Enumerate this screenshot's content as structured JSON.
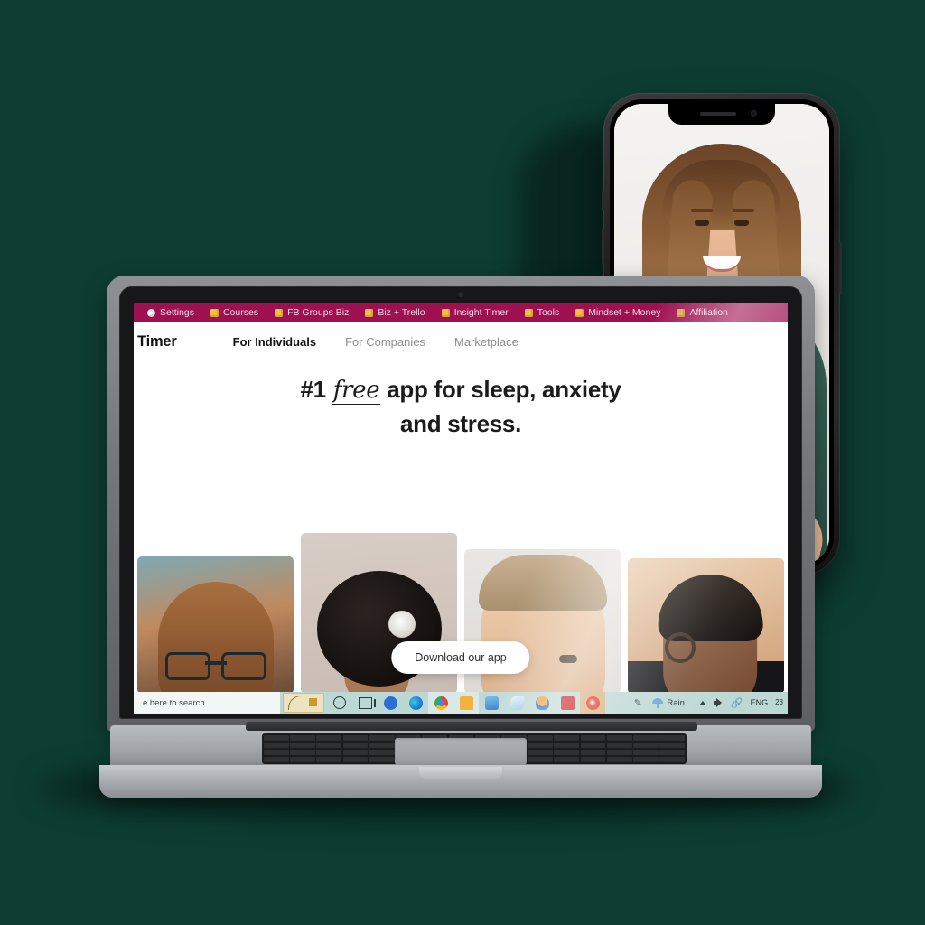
{
  "scene": {
    "background_color": "#0d3d32",
    "devices": [
      "laptop",
      "smartphone"
    ]
  },
  "phone": {
    "name": "smartphone-mockup",
    "screen_content": "woman smiling in namaste prayer pose wearing green t-shirt",
    "notch": {
      "speaker": "earpiece-speaker",
      "camera": "front-camera"
    }
  },
  "laptop": {
    "name": "laptop-mockup",
    "browser": {
      "bookmarks_bar": {
        "background_color": "#9e1050",
        "items": [
          {
            "label": "Settings",
            "icon": "dot-favicon"
          },
          {
            "label": "Courses",
            "icon": "folder-icon"
          },
          {
            "label": "FB Groups Biz",
            "icon": "folder-icon"
          },
          {
            "label": "Biz + Trello",
            "icon": "folder-icon"
          },
          {
            "label": "Insight Timer",
            "icon": "folder-icon"
          },
          {
            "label": "Tools",
            "icon": "folder-icon"
          },
          {
            "label": "Mindset + Money",
            "icon": "folder-icon"
          },
          {
            "label": "Affiliation",
            "icon": "folder-icon"
          }
        ]
      },
      "site": {
        "brand": "Timer",
        "nav": [
          {
            "label": "For Individuals",
            "active": true
          },
          {
            "label": "For Companies",
            "active": false
          },
          {
            "label": "Marketplace",
            "active": false
          }
        ],
        "hero": {
          "line1_before": "#1 ",
          "line1_script": "free",
          "line1_after": " app for sleep, anxiety",
          "line2": "and stress."
        },
        "cta": {
          "label": "Download our app"
        },
        "cards": [
          {
            "alt": "bald man with glasses"
          },
          {
            "alt": "woman with afro hair and white flower"
          },
          {
            "alt": "older man with blond hair"
          },
          {
            "alt": "woman with hoop earring"
          }
        ]
      }
    },
    "taskbar": {
      "background_color": "#bcd8d4",
      "search_placeholder": "e here to search",
      "widget": "golden-spiral-widget",
      "pinned": [
        {
          "name": "cortana-icon"
        },
        {
          "name": "task-view-icon"
        },
        {
          "name": "blue-app-icon",
          "color": "#2b6fd4"
        },
        {
          "name": "edge-icon",
          "color": "#1e8bcd"
        },
        {
          "name": "chrome-icon",
          "color": "#f2b600"
        },
        {
          "name": "file-explorer-icon",
          "color": "#f2b33d"
        },
        {
          "name": "photos-icon",
          "color": "#3b84d6"
        },
        {
          "name": "notes-icon",
          "color": "#cfe3f0"
        },
        {
          "name": "headphones-icon",
          "color": "#2f6fd0"
        },
        {
          "name": "acrobat-icon",
          "color": "#cc2127"
        },
        {
          "name": "active-app-icon",
          "color": "#d63b2a"
        }
      ],
      "tray": {
        "pen_icon": "pen-icon",
        "weather_label": "Rain...",
        "weather_icon": "umbrella-icon",
        "show_hidden_icon": "chevron-up-icon",
        "volume_icon": "speaker-icon",
        "bluetooth_icon": "bluetooth-icon",
        "language": "ENG",
        "clock_line1": "",
        "clock_line2": "23"
      }
    }
  }
}
